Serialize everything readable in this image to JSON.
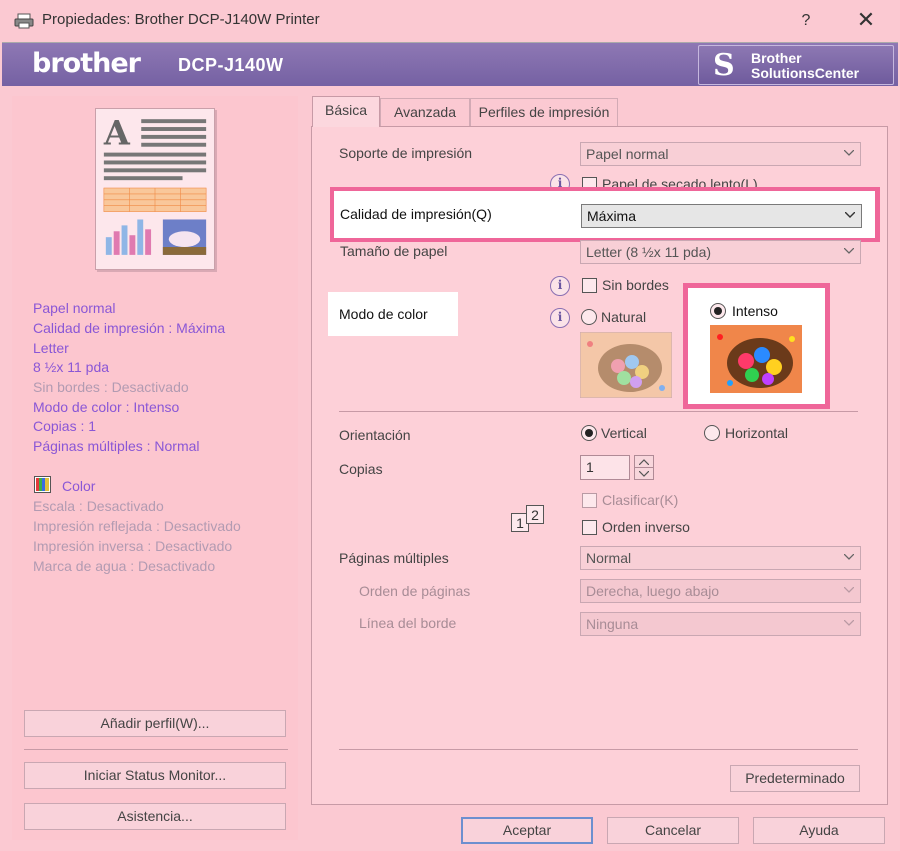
{
  "window": {
    "title": "Propiedades: Brother DCP-J140W Printer",
    "help_label": "?",
    "close_label": "✕"
  },
  "banner": {
    "logo": "brother",
    "model": "DCP-J140W",
    "solutions_icon": "S",
    "solutions_line1": "Brother",
    "solutions_line2": "SolutionsCenter"
  },
  "summary": {
    "items": [
      {
        "text": "Papel normal",
        "enabled": true
      },
      {
        "text": "Calidad de impresión : Máxima",
        "enabled": true
      },
      {
        "text": "Letter",
        "enabled": true
      },
      {
        "text": "8 ½x 11 pda",
        "enabled": true
      },
      {
        "text": "Sin bordes : Desactivado",
        "enabled": false
      },
      {
        "text": "Modo de color : Intenso",
        "enabled": true
      },
      {
        "text": "Copias : 1",
        "enabled": true
      },
      {
        "text": "Páginas múltiples : Normal",
        "enabled": true
      }
    ],
    "color_label": "Color",
    "extra": [
      {
        "text": "Escala : Desactivado"
      },
      {
        "text": "Impresión reflejada : Desactivado"
      },
      {
        "text": "Impresión inversa : Desactivado"
      },
      {
        "text": "Marca de agua : Desactivado"
      }
    ]
  },
  "left_buttons": {
    "add_profile": "Añadir perfil(W)...",
    "status_monitor": "Iniciar Status Monitor...",
    "support": "Asistencia..."
  },
  "tabs": [
    {
      "label": "Básica",
      "active": true
    },
    {
      "label": "Avanzada",
      "active": false
    },
    {
      "label": "Perfiles de impresión",
      "active": false
    }
  ],
  "basic": {
    "media_label": "Soporte de impresión",
    "media_value": "Papel normal",
    "slow_dry_label": "Papel de secado lento(L)",
    "quality_label": "Calidad de impresión(Q)",
    "quality_value": "Máxima",
    "paper_size_label": "Tamaño de papel",
    "paper_size_value": "Letter (8 ½x 11 pda)",
    "borderless_label": "Sin bordes",
    "color_mode_label": "Modo de color",
    "natural_label": "Natural",
    "vivid_label": "Intenso",
    "orientation_label": "Orientación",
    "portrait_label": "Vertical",
    "landscape_label": "Horizontal",
    "copies_label": "Copias",
    "copies_value": "1",
    "collate_label": "Clasificar(K)",
    "reverse_label": "Orden inverso",
    "pages_icon_1": "1",
    "pages_icon_2": "2",
    "multi_page_label": "Páginas múltiples",
    "multi_page_value": "Normal",
    "page_order_label": "Orden de páginas",
    "page_order_value": "Derecha, luego abajo",
    "border_line_label": "Línea del borde",
    "border_line_value": "Ninguna",
    "default_button": "Predeterminado",
    "info_icon": "i"
  },
  "footer": {
    "accept": "Aceptar",
    "cancel": "Cancelar",
    "help": "Ayuda"
  },
  "colors": {
    "background": "#fbc9d2",
    "banner": "#7561a3",
    "highlight": "#ef6699",
    "summary_text": "#8a57d6"
  }
}
